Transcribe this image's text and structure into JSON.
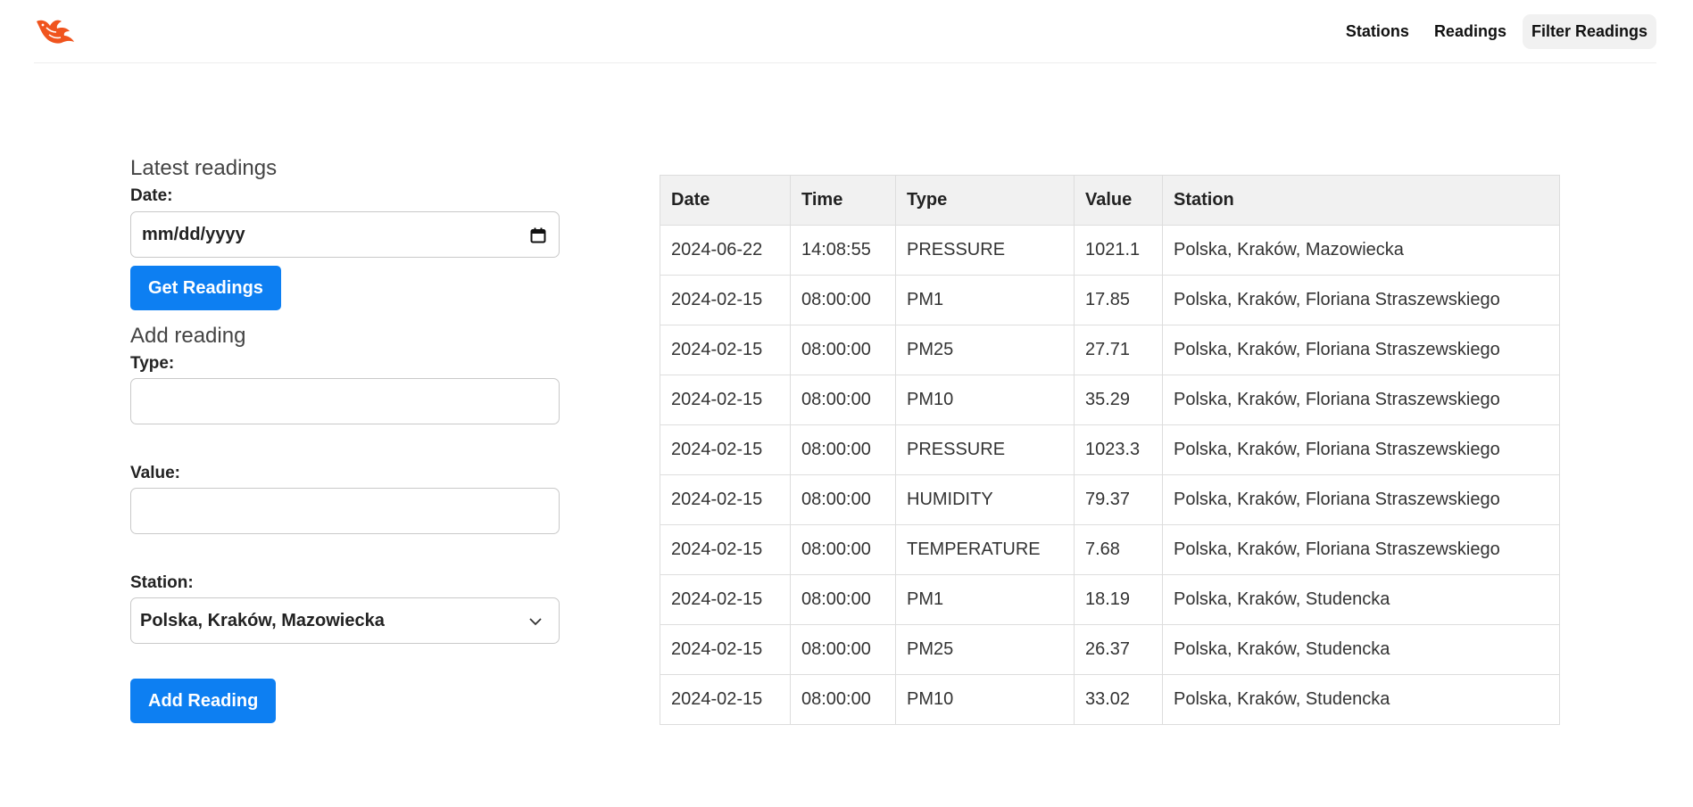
{
  "nav": {
    "items": [
      {
        "label": "Stations"
      },
      {
        "label": "Readings"
      },
      {
        "label": "Filter Readings"
      }
    ]
  },
  "latest": {
    "title": "Latest readings",
    "date_label": "Date:",
    "date_placeholder": "mm/dd/yyyy",
    "button": "Get Readings"
  },
  "add": {
    "title": "Add reading",
    "type_label": "Type:",
    "type_value": "",
    "value_label": "Value:",
    "value_value": "",
    "station_label": "Station:",
    "station_selected": "Polska, Kraków, Mazowiecka",
    "button": "Add Reading"
  },
  "table": {
    "headers": [
      "Date",
      "Time",
      "Type",
      "Value",
      "Station"
    ],
    "rows": [
      [
        "2024-06-22",
        "14:08:55",
        "PRESSURE",
        "1021.1",
        "Polska, Kraków, Mazowiecka"
      ],
      [
        "2024-02-15",
        "08:00:00",
        "PM1",
        "17.85",
        "Polska, Kraków, Floriana Straszewskiego"
      ],
      [
        "2024-02-15",
        "08:00:00",
        "PM25",
        "27.71",
        "Polska, Kraków, Floriana Straszewskiego"
      ],
      [
        "2024-02-15",
        "08:00:00",
        "PM10",
        "35.29",
        "Polska, Kraków, Floriana Straszewskiego"
      ],
      [
        "2024-02-15",
        "08:00:00",
        "PRESSURE",
        "1023.3",
        "Polska, Kraków, Floriana Straszewskiego"
      ],
      [
        "2024-02-15",
        "08:00:00",
        "HUMIDITY",
        "79.37",
        "Polska, Kraków, Floriana Straszewskiego"
      ],
      [
        "2024-02-15",
        "08:00:00",
        "TEMPERATURE",
        "7.68",
        "Polska, Kraków, Floriana Straszewskiego"
      ],
      [
        "2024-02-15",
        "08:00:00",
        "PM1",
        "18.19",
        "Polska, Kraków, Studencka"
      ],
      [
        "2024-02-15",
        "08:00:00",
        "PM25",
        "26.37",
        "Polska, Kraków, Studencka"
      ],
      [
        "2024-02-15",
        "08:00:00",
        "PM10",
        "33.02",
        "Polska, Kraków, Studencka"
      ]
    ]
  },
  "icons": {
    "logo": "phoenix-logo-icon",
    "calendar": "calendar-icon",
    "dropdown": "chevron-down-icon"
  },
  "colors": {
    "accent": "#0d7ff2",
    "logo": "#f0541e",
    "header_bg": "#f1f1f1"
  }
}
